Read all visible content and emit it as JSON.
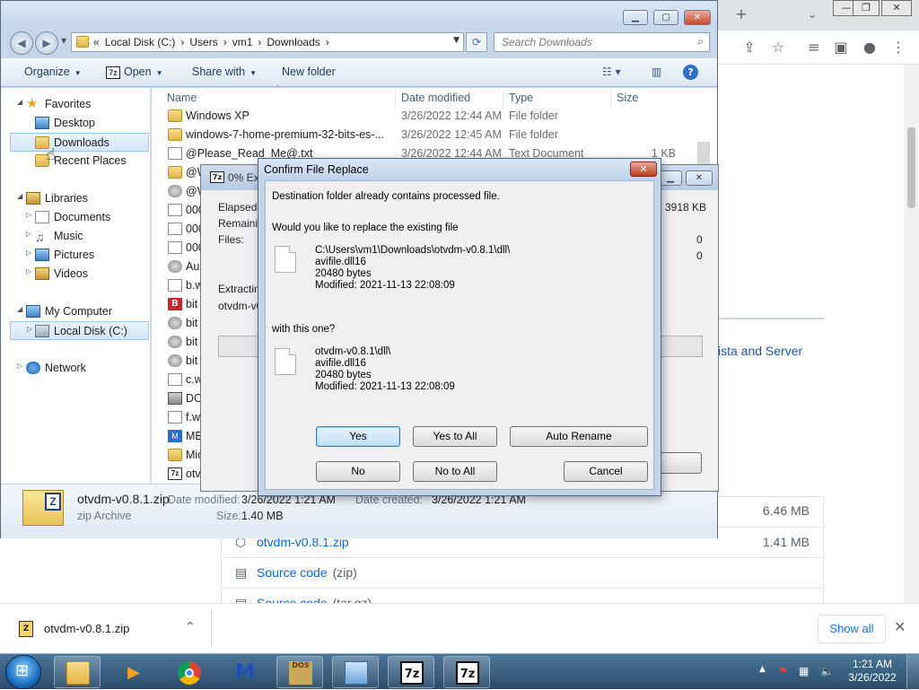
{
  "browser": {
    "new_tab_icon": "plus-icon",
    "page_text": {
      "vista_server_link": "ista and Server"
    },
    "assets": [
      {
        "icon": "package-icon",
        "name": "",
        "ext": "",
        "size": "6.46 MB"
      },
      {
        "icon": "package-icon",
        "name": "otvdm-v0.8.1.zip",
        "ext": "",
        "size": "1.41 MB"
      },
      {
        "icon": "file-zip-icon",
        "name": "Source code",
        "ext": "(zip)",
        "size": ""
      },
      {
        "icon": "file-zip-icon",
        "name": "Source code",
        "ext": "(tar.gz)",
        "size": ""
      }
    ],
    "download_shelf": {
      "file_name": "otvdm-v0.8.1.zip",
      "show_all": "Show all"
    }
  },
  "explorer": {
    "breadcrumb": [
      "«",
      "Local Disk (C:)",
      "›",
      "Users",
      "›",
      "vm1",
      "›",
      "Downloads",
      "›"
    ],
    "search_placeholder": "Search Downloads",
    "toolbar": {
      "organize": "Organize",
      "open": "Open",
      "share_with": "Share with",
      "new_folder": "New folder"
    },
    "nav": {
      "favorites": "Favorites",
      "desktop": "Desktop",
      "downloads": "Downloads",
      "recent_places": "Recent Places",
      "libraries": "Libraries",
      "documents": "Documents",
      "music": "Music",
      "pictures": "Pictures",
      "videos": "Videos",
      "my_computer": "My Computer",
      "local_disk": "Local Disk (C:)",
      "network": "Network"
    },
    "columns": {
      "name": "Name",
      "date": "Date modified",
      "type": "Type",
      "size": "Size"
    },
    "files": [
      {
        "name": "Windows XP",
        "date": "3/26/2022 12:44 AM",
        "type": "File folder",
        "size": "",
        "icon": "folder-icon"
      },
      {
        "name": "windows-7-home-premium-32-bits-es-...",
        "date": "3/26/2022 12:45 AM",
        "type": "File folder",
        "size": "",
        "icon": "folder-icon"
      },
      {
        "name": "@Please_Read_Me@.txt",
        "date": "3/26/2022 12:44 AM",
        "type": "Text Document",
        "size": "1 KB",
        "icon": "text-file-icon"
      },
      {
        "name": "@W",
        "date": "",
        "type": "",
        "size": "",
        "icon": "archive-icon"
      },
      {
        "name": "@W",
        "date": "",
        "type": "",
        "size": "",
        "icon": "archive-icon"
      },
      {
        "name": "000",
        "date": "",
        "type": "",
        "size": "",
        "icon": "file-icon"
      },
      {
        "name": "000",
        "date": "",
        "type": "",
        "size": "",
        "icon": "file-icon"
      },
      {
        "name": "000",
        "date": "",
        "type": "",
        "size": "",
        "icon": "file-icon"
      },
      {
        "name": "Au",
        "date": "",
        "type": "",
        "size": "",
        "icon": "gear-file-icon"
      },
      {
        "name": "b.w",
        "date": "",
        "type": "",
        "size": "",
        "icon": "file-icon"
      },
      {
        "name": "bit",
        "date": "",
        "type": "",
        "size": "",
        "icon": "b-app-icon"
      },
      {
        "name": "bit",
        "date": "",
        "type": "",
        "size": "",
        "icon": "app-icon"
      },
      {
        "name": "bit",
        "date": "",
        "type": "",
        "size": "",
        "icon": "app-icon"
      },
      {
        "name": "bit",
        "date": "",
        "type": "",
        "size": "",
        "icon": "app-icon"
      },
      {
        "name": "c.w",
        "date": "",
        "type": "",
        "size": "",
        "icon": "file-icon"
      },
      {
        "name": "DO",
        "date": "",
        "type": "",
        "size": "",
        "icon": "batch-file-icon"
      },
      {
        "name": "f.w",
        "date": "",
        "type": "",
        "size": "",
        "icon": "file-icon"
      },
      {
        "name": "MB",
        "date": "",
        "type": "",
        "size": "",
        "icon": "malwarebytes-icon"
      },
      {
        "name": "Mic",
        "date": "",
        "type": "",
        "size": "",
        "icon": "archive-icon"
      },
      {
        "name": "otv",
        "date": "",
        "type": "",
        "size": "",
        "icon": "zip-archive-icon"
      }
    ],
    "details": {
      "file_name": "otvdm-v0.8.1.zip",
      "file_type": "zip Archive",
      "date_modified_label": "Date modified:",
      "date_modified": "3/26/2022 1:21 AM",
      "date_created_label": "Date created:",
      "date_created": "3/26/2022 1:21 AM",
      "size_label": "Size:",
      "size": "1.40 MB"
    }
  },
  "progress": {
    "title": "0% Ext",
    "elapsed": "Elapsed ti",
    "remaining": "Remaining",
    "files": "Files:",
    "size_value": "3918 KB",
    "files_value": "0",
    "second_value": "0",
    "extracting": "Extracting",
    "current": "otvdm-v0"
  },
  "dialog": {
    "title": "Confirm File Replace",
    "message": "Destination folder already contains processed file.",
    "question": "Would you like to replace the existing file",
    "existing": {
      "path": "C:\\Users\\vm1\\Downloads\\otvdm-v0.8.1\\dll\\",
      "name": "avifile.dll16",
      "size": "20480 bytes",
      "modified": "Modified: 2021-11-13 22:08:09"
    },
    "with_this": "with this one?",
    "incoming": {
      "path": "otvdm-v0.8.1\\dll\\",
      "name": "avifile.dll16",
      "size": "20480 bytes",
      "modified": "Modified: 2021-11-13 22:08:09"
    },
    "buttons": {
      "yes": "Yes",
      "yes_to_all": "Yes to All",
      "auto_rename": "Auto Rename",
      "no": "No",
      "no_to_all": "No to All",
      "cancel": "Cancel"
    }
  },
  "taskbar": {
    "apps": [
      "explorer",
      "media-player",
      "chrome",
      "malwarebytes",
      "dosbox",
      "control-panel",
      "7-zip",
      "7-zip"
    ],
    "sevenzip_label": "7z",
    "time": "1:21 AM",
    "date": "3/26/2022"
  }
}
